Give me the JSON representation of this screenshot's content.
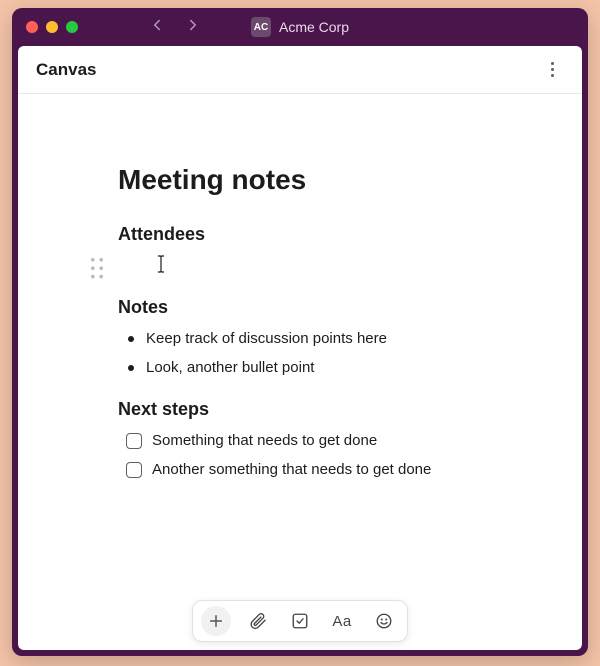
{
  "workspace": {
    "badge": "AC",
    "name": "Acme Corp"
  },
  "header": {
    "title": "Canvas"
  },
  "document": {
    "title": "Meeting notes",
    "sections": {
      "attendees": {
        "heading": "Attendees"
      },
      "notes": {
        "heading": "Notes",
        "bullets": [
          "Keep track of discussion points here",
          "Look, another bullet point"
        ]
      },
      "next_steps": {
        "heading": "Next steps",
        "items": [
          {
            "checked": false,
            "text": "Something that needs to get done"
          },
          {
            "checked": false,
            "text": "Another something that needs to get done"
          }
        ]
      }
    }
  },
  "toolbar": {
    "plus": "Add",
    "attach": "Attach",
    "checklist": "Checklist",
    "format": "Aa",
    "emoji": "Emoji"
  }
}
